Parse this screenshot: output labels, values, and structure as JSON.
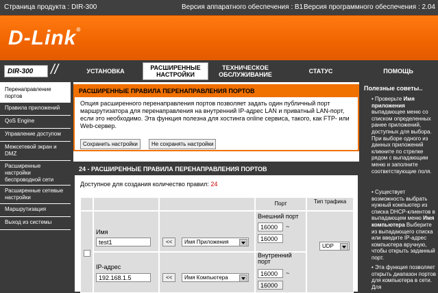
{
  "topbar": {
    "product_label": "Страница продукта : DIR-300",
    "hw_label": "Версия аппаратного обеспечения : B1",
    "fw_label": "Версия программного обеспечения : 2.04"
  },
  "brand": {
    "logo": "D-Link",
    "model": "DIR-300"
  },
  "tabs": [
    {
      "label": "УСТАНОВКА"
    },
    {
      "label": "РАСШИРЕННЫЕ НАСТРОЙКИ"
    },
    {
      "label": "ТЕХНИЧЕСКОЕ ОБСЛУЖИВАНИЕ"
    },
    {
      "label": "СТАТУС"
    },
    {
      "label": "ПОМОЩЬ"
    }
  ],
  "sidebar": {
    "items": [
      {
        "label": "Перенаправление портов"
      },
      {
        "label": "Правила приложений"
      },
      {
        "label": "QoS Engine"
      },
      {
        "label": "Управление доступом"
      },
      {
        "label": "Межсетевой экран и DMZ"
      },
      {
        "label": "Расширенные настройки беспроводной сети"
      },
      {
        "label": "Расширенные сетевые настройки"
      },
      {
        "label": "Маршрутизация"
      },
      {
        "label": "Выход из системы"
      }
    ]
  },
  "section1": {
    "title": "РАСШИРЕННЫЕ ПРАВИЛА ПЕРЕНАПРАВЛЕНИЯ ПОРТОВ",
    "description": "Опция расширенного перенаправления портов позволяет задать один публичный порт маршрутизатора для перенаправления на внутренний IP-адрес LAN и приватный LAN-порт, если это необходимо. Эта функция полезна для хостинга online сервиса, такого, как FTP- или Web-сервер.",
    "save_label": "Сохранить настройки",
    "nosave_label": "Не сохранять настройки"
  },
  "section2": {
    "title": "24 - РАСШИРЕННЫЕ ПРАВИЛА ПЕРЕНАПРАВЛЕНИЯ ПОРТОВ",
    "avail_label": "Доступное для создания количество правил:",
    "avail_count": "24",
    "col_port": "Порт",
    "col_traffic": "Тип трафика",
    "name_label": "Имя",
    "name_value": "test1",
    "app_btn": "<<",
    "app_select": "Имя Приложения",
    "ext_port_label": "Внешний порт",
    "ext_port_from": "16000",
    "ext_port_sep": "~",
    "ext_port_to": "16000",
    "protocol": "UDP",
    "ip_label": "IP-адрес",
    "ip_value": "192.168.1.5",
    "comp_btn": "<<",
    "comp_select": "Имя Компьютера",
    "int_port_label": "Внутренний порт",
    "int_port_from": "16000",
    "int_port_sep": "~",
    "int_port_to": "16000"
  },
  "hints": {
    "title": "Полезные советы..",
    "p1_pre": "Проверьте ",
    "p1_bold": "Имя приложения",
    "p1_post": " выпадающее меню со списком определенных ранее приложений, доступных для выбора. При выборе одного из данных приложений кликните по стрелке рядом с выпадающим меню и заполните соответствующие поля.",
    "p2_pre": "Существует возможность выбрать нужный компьютер из списка DHCP-клиентов в выпадающем меню ",
    "p2_bold": "Имя компьютера",
    "p2_post": " Выберите из выпадающего списка или введите IP-адрес компьютера вручную, чтобы открыть заданный порт.",
    "p3": "Эта функция позволяет открыть диапазон портов для компьютера в сети. Для"
  }
}
